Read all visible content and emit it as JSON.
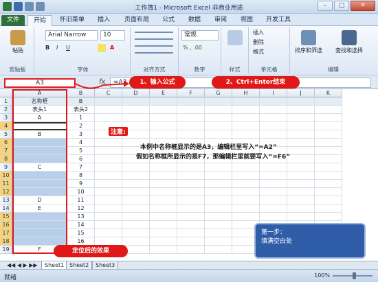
{
  "window": {
    "title": "工作簿1 - Microsoft Excel 非商业用途"
  },
  "tabs": [
    "文件",
    "开始",
    "怀旧菜单",
    "插入",
    "页面布局",
    "公式",
    "数据",
    "审阅",
    "视图",
    "开发工具"
  ],
  "ribbon": {
    "clipboard": {
      "paste": "粘贴",
      "label": "剪贴板"
    },
    "font": {
      "name": "Arial Narrow",
      "size": "10",
      "label": "字体"
    },
    "alignment": {
      "label": "对齐方式"
    },
    "number": {
      "format": "常规",
      "label": "数字"
    },
    "styles": {
      "label": "样式"
    },
    "cells": {
      "insert": "插入",
      "delete": "删除",
      "format": "格式",
      "label": "单元格"
    },
    "editing": {
      "sort": "排序和筛选",
      "find": "查找和选择",
      "label": "编辑"
    }
  },
  "formula_bar": {
    "name_box": "A3",
    "fx": "fx",
    "formula": "=A2"
  },
  "callouts": {
    "step1": "1、输入公式",
    "step2": "2、Ctrl+Enter结束",
    "result": "定位后的效果"
  },
  "columns": [
    "A",
    "B",
    "C",
    "D",
    "E",
    "F",
    "G",
    "H",
    "I",
    "J",
    "K"
  ],
  "rows": [
    {
      "n": "1",
      "a": "名称框",
      "b": "B",
      "blue": false
    },
    {
      "n": "2",
      "a": "表头1",
      "b": "表头2",
      "blue": false
    },
    {
      "n": "3",
      "a": "A",
      "b": "1",
      "blue": false
    },
    {
      "n": "4",
      "a": "",
      "b": "2",
      "blue": false,
      "active": true
    },
    {
      "n": "5",
      "a": "B",
      "b": "3",
      "blue": false
    },
    {
      "n": "6",
      "a": "",
      "b": "4",
      "blue": true
    },
    {
      "n": "7",
      "a": "",
      "b": "5",
      "blue": true
    },
    {
      "n": "8",
      "a": "",
      "b": "6",
      "blue": true
    },
    {
      "n": "9",
      "a": "C",
      "b": "7",
      "blue": false
    },
    {
      "n": "10",
      "a": "",
      "b": "8",
      "blue": true
    },
    {
      "n": "11",
      "a": "",
      "b": "9",
      "blue": true
    },
    {
      "n": "12",
      "a": "",
      "b": "10",
      "blue": true
    },
    {
      "n": "13",
      "a": "D",
      "b": "11",
      "blue": false
    },
    {
      "n": "14",
      "a": "E",
      "b": "12",
      "blue": false
    },
    {
      "n": "15",
      "a": "",
      "b": "13",
      "blue": true
    },
    {
      "n": "16",
      "a": "",
      "b": "14",
      "blue": true
    },
    {
      "n": "17",
      "a": "",
      "b": "15",
      "blue": true
    },
    {
      "n": "18",
      "a": "",
      "b": "16",
      "blue": true
    },
    {
      "n": "19",
      "a": "F",
      "b": "17",
      "blue": false
    }
  ],
  "notice": {
    "title": "注意:",
    "line1": "本例中名称框显示的是A3，编辑栏里写入“=A2”",
    "line2": "假如名称框所显示的是F7，那编辑栏里就要写入“=F6”"
  },
  "tip": {
    "line1": "第一步：",
    "line2": "填满空白处"
  },
  "sheets": [
    "Sheet1",
    "Sheet2",
    "Sheet3"
  ],
  "status": {
    "ready": "就绪",
    "zoom": "100%"
  },
  "colors": {
    "accent_red": "#e01818",
    "fill_blue": "#b8d0ea",
    "tip_blue": "#2f5da8"
  }
}
